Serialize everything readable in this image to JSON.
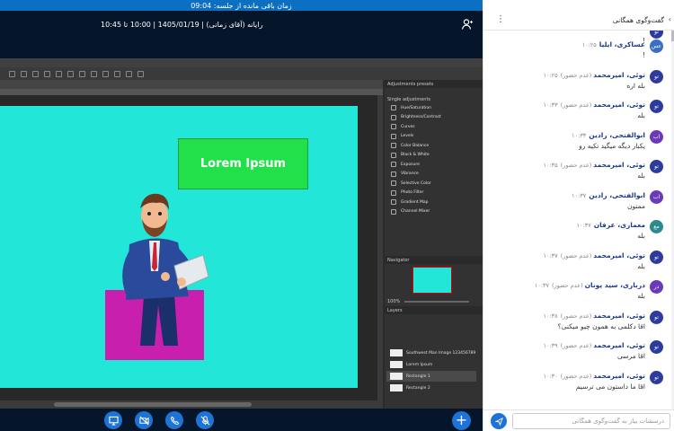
{
  "timer": {
    "text": "زمان باقی مانده از جلسه: 09:04"
  },
  "session": {
    "info": "رایانه (آقای زمانی) | 1405/01/19 | 10:00 تا 10:45"
  },
  "photoshop": {
    "adjust_panel_title": "Adjustments presets",
    "single_adjust_title": "Single adjustments",
    "adjustments": [
      "Hue/Saturation",
      "Brightness/Contrast",
      "Curves",
      "Levels",
      "Color Balance",
      "Black & White",
      "Exposure",
      "Vibrance",
      "Selective Color",
      "Photo Filter",
      "Gradient Map",
      "Channel Mixer"
    ],
    "navigator_title": "Navigator",
    "zoom": "100%",
    "layers_title": "Layers",
    "layers": [
      "Southwest Man Image 123456789",
      "Lorem Ipsum",
      "Rectangle 1",
      "Rectangle 2"
    ],
    "artboard_text": "Lorem Ipsum",
    "colors": {
      "artboard": "#22e6d8",
      "green": "#22e04a",
      "magenta": "#c81fae"
    }
  },
  "chat": {
    "title": "گفت‌وگوی همگانی",
    "input_placeholder": "درسشات بیاز به گفت‌وگوی همگانی",
    "messages": [
      {
        "avatar": "تو",
        "avatar_color": "#2d3a9e",
        "name": "",
        "status": "",
        "time": "",
        "text": "!"
      },
      {
        "avatar": "عس",
        "avatar_color": "#3a6fc2",
        "name": "عساکری، ایلیا",
        "status": "",
        "time": "۱۰:۲۵",
        "text": "!"
      },
      {
        "avatar": "تو",
        "avatar_color": "#2d3a9e",
        "name": "توئی، امیرمحمد",
        "status": "(عدم حضور)",
        "time": "۱۰:۲۵",
        "text": "بله اره"
      },
      {
        "avatar": "تو",
        "avatar_color": "#2d3a9e",
        "name": "توئی، امیرمحمد",
        "status": "(عدم حضور)",
        "time": "۱۰:۳۳",
        "text": "بله"
      },
      {
        "avatar": "اب",
        "avatar_color": "#6a3ab8",
        "name": "ابوالفتحی، رادین",
        "status": "",
        "time": "۱۰:۳۳",
        "text": "یکبار دیگه میگید تکیه رو"
      },
      {
        "avatar": "تو",
        "avatar_color": "#2d3a9e",
        "name": "توئی، امیرمحمد",
        "status": "(عدم حضور)",
        "time": "۱۰:۳۵",
        "text": "بله"
      },
      {
        "avatar": "اب",
        "avatar_color": "#6a3ab8",
        "name": "ابوالفتحی، رادین",
        "status": "",
        "time": "۱۰:۳۷",
        "text": "ممنون"
      },
      {
        "avatar": "مع",
        "avatar_color": "#2b8a8e",
        "name": "معماری، عرفان",
        "status": "",
        "time": "۱۰:۳۷",
        "text": "بله"
      },
      {
        "avatar": "تو",
        "avatar_color": "#2d3a9e",
        "name": "توئی، امیرمحمد",
        "status": "(عدم حضور)",
        "time": "۱۰:۳۷",
        "text": "بله"
      },
      {
        "avatar": "در",
        "avatar_color": "#6a3ab8",
        "name": "درباری، سید یونان",
        "status": "(عدم حضور)",
        "time": "۱۰:۳۷",
        "text": "بله"
      },
      {
        "avatar": "تو",
        "avatar_color": "#2d3a9e",
        "name": "توئی، امیرمحمد",
        "status": "(عدم حضور)",
        "time": "۱۰:۳۸",
        "text": "اقا دکلمی به همون چیو میکنی؟"
      },
      {
        "avatar": "تو",
        "avatar_color": "#2d3a9e",
        "name": "توئی، امیرمحمد",
        "status": "(عدم حضور)",
        "time": "۱۰:۳۹",
        "text": "اقا مرسی"
      },
      {
        "avatar": "تو",
        "avatar_color": "#2d3a9e",
        "name": "توئی، امیرمحمد",
        "status": "(عدم حضور)",
        "time": "۱۰:۳۰",
        "text": "اقا ما داستون می ترسیم"
      }
    ]
  }
}
